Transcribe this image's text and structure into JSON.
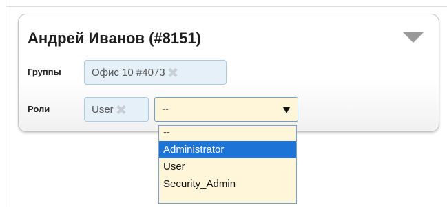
{
  "card": {
    "title": "Андрей Иванов (#8151)",
    "collapse_icon": "triangle-down-icon"
  },
  "groups": {
    "label": "Группы",
    "tags": [
      {
        "label": "Офис 10 #4073",
        "remove_icon": "remove-x-icon"
      }
    ]
  },
  "roles": {
    "label": "Роли",
    "tags": [
      {
        "label": "User",
        "remove_icon": "remove-x-icon"
      }
    ],
    "select": {
      "value": "--",
      "arrow_icon": "caret-down-icon",
      "options": [
        "--",
        "Administrator",
        "User",
        "Security_Admin"
      ],
      "highlighted_option": "Administrator"
    }
  },
  "colors": {
    "tag_background": "#e5f0f9",
    "tag_border": "#a9cbe3",
    "select_background": "#fff5d8",
    "highlight": "#1e73d6"
  }
}
